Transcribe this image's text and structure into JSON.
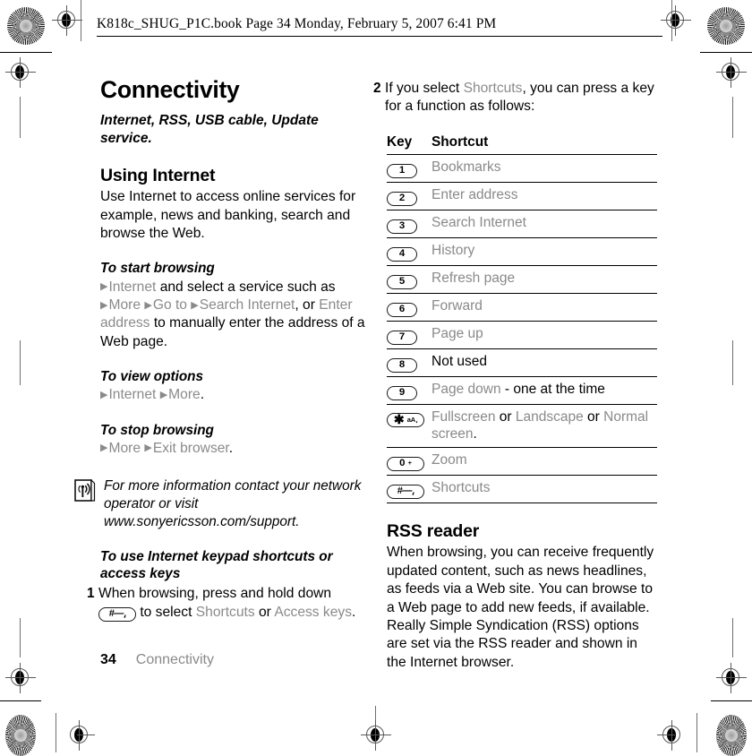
{
  "print_header": {
    "text": "K818c_SHUG_P1C.book  Page 34  Monday, February 5, 2007  6:41 PM"
  },
  "colors": {
    "gray_menu_text": "#8a8a8a",
    "body_text": "#000000",
    "rule": "#000000"
  },
  "left_column": {
    "chapter_title": "Connectivity",
    "chapter_subtitle": "Internet, RSS, USB cable, Update service.",
    "section_title": "Using Internet",
    "section_intro": "Use Internet to access online services for example, news and banking, search and browse the Web.",
    "proc_start_browsing": {
      "heading": "To start browsing",
      "step_parts": {
        "menu_internet": "Internet",
        "text_1": "and select a service such as",
        "menu_more": "More",
        "menu_goto": "Go to",
        "menu_search_internet": "Search Internet",
        "text_2": ", or",
        "menu_enter_address": "Enter address",
        "text_3": "to manually enter the address of a Web page."
      }
    },
    "proc_view_options": {
      "heading": "To view options",
      "menu_internet": "Internet",
      "menu_more": "More",
      "period": "."
    },
    "proc_stop_browsing": {
      "heading": "To stop browsing",
      "menu_more": "More",
      "menu_exit_browser": "Exit browser",
      "period": "."
    },
    "note": {
      "icon": "signal-antenna-icon",
      "text": "For more information contact your network operator or visit www.sonyericsson.com/support."
    },
    "proc_keypad_shortcuts": {
      "heading": "To use Internet keypad shortcuts or access keys",
      "step_number": "1",
      "text_1": "When browsing, press and hold down",
      "key_label": "#",
      "text_2": "to select",
      "menu_shortcuts": "Shortcuts",
      "text_3": "or",
      "menu_access_keys": "Access keys",
      "period": "."
    }
  },
  "right_column": {
    "step_two": {
      "number": "2",
      "text_1": "If you select",
      "menu_shortcuts": "Shortcuts",
      "text_2": ", you can press a key for a function as follows:"
    },
    "table": {
      "headers": [
        "Key",
        "Shortcut"
      ],
      "rows": [
        {
          "key": "1",
          "key_type": "num",
          "shortcut": "Bookmarks",
          "shortcut_color": "gray"
        },
        {
          "key": "2",
          "key_type": "num",
          "shortcut": "Enter address",
          "shortcut_color": "gray"
        },
        {
          "key": "3",
          "key_type": "num",
          "shortcut": "Search Internet",
          "shortcut_color": "gray"
        },
        {
          "key": "4",
          "key_type": "num",
          "shortcut": "History",
          "shortcut_color": "gray"
        },
        {
          "key": "5",
          "key_type": "num",
          "shortcut": "Refresh page",
          "shortcut_color": "gray"
        },
        {
          "key": "6",
          "key_type": "num",
          "shortcut": "Forward",
          "shortcut_color": "gray"
        },
        {
          "key": "7",
          "key_type": "num",
          "shortcut": "Page up",
          "shortcut_color": "gray"
        },
        {
          "key": "8",
          "key_type": "num",
          "shortcut": "Not used",
          "shortcut_color": "black"
        },
        {
          "key": "9",
          "key_type": "num",
          "shortcut": "Page down",
          "shortcut_color": "gray",
          "shortcut_suffix": " - one at the time"
        },
        {
          "key": "*aA",
          "key_type": "star",
          "shortcut": "Fullscreen",
          "shortcut_color": "gray",
          "shortcut_mixed": [
            {
              "t": "Fullscreen",
              "c": "gray"
            },
            {
              "t": " or ",
              "c": "black"
            },
            {
              "t": "Landscape",
              "c": "gray"
            },
            {
              "t": " or ",
              "c": "black"
            },
            {
              "t": "Normal screen",
              "c": "gray"
            },
            {
              "t": ".",
              "c": "black"
            }
          ]
        },
        {
          "key": "0 +",
          "key_type": "zero",
          "shortcut": "Zoom",
          "shortcut_color": "gray"
        },
        {
          "key": "#",
          "key_type": "hash",
          "shortcut": "Shortcuts",
          "shortcut_color": "gray"
        }
      ]
    },
    "rss": {
      "title": "RSS reader",
      "body": "When browsing, you can receive frequently updated content, such as news headlines, as feeds via a Web site. You can browse to a Web page to add new feeds, if available. Really Simple Syndication (RSS) options are set via the RSS reader and shown in the Internet browser."
    }
  },
  "footer": {
    "page_number": "34",
    "chapter": "Connectivity"
  }
}
